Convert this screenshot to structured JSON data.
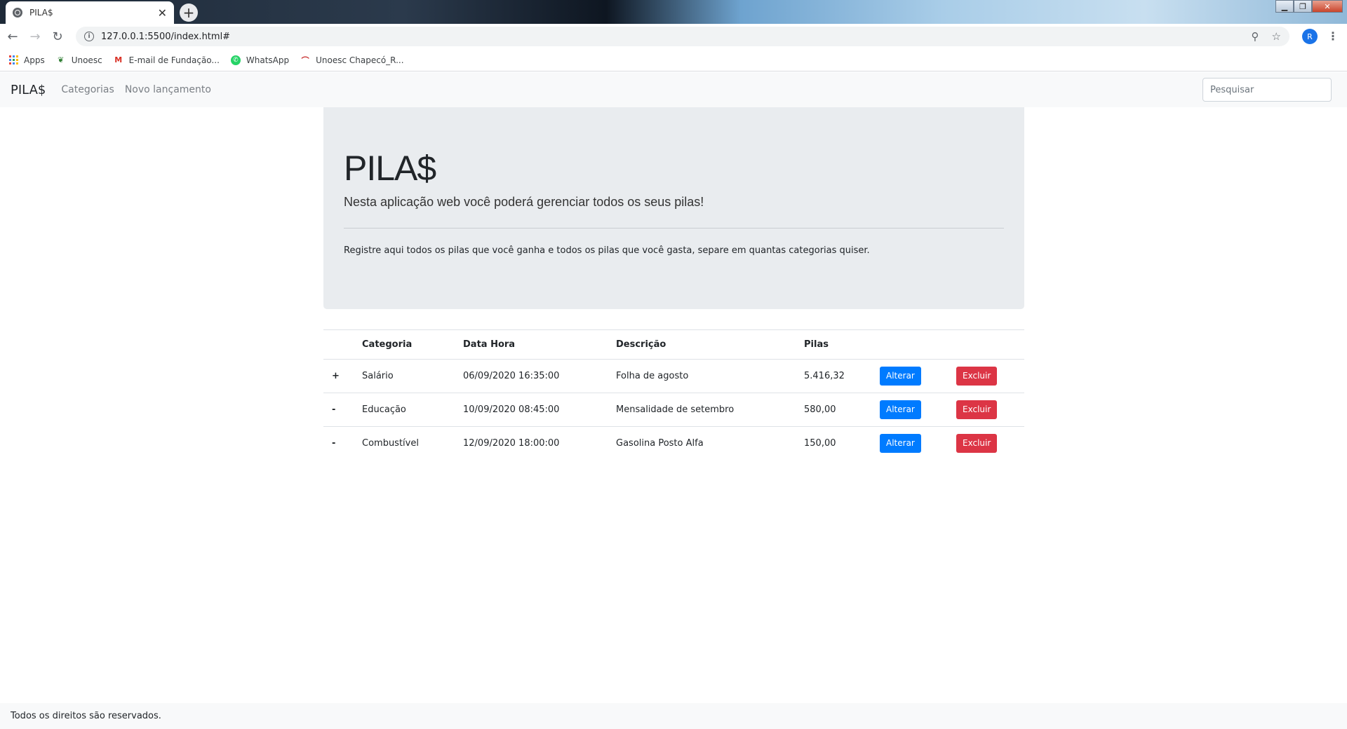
{
  "browser": {
    "tab_title": "PILA$",
    "tab_close": "✕",
    "new_tab": "+",
    "url": "127.0.0.1:5500/index.html#",
    "profile_initial": "R",
    "bookmarks": [
      {
        "label": "Apps",
        "icon": "apps-grid-icon"
      },
      {
        "label": "Unoesc",
        "icon": "unoesc-icon"
      },
      {
        "label": "E-mail de Fundação...",
        "icon": "gmail-icon"
      },
      {
        "label": "WhatsApp",
        "icon": "whatsapp-icon"
      },
      {
        "label": "Unoesc Chapecó_R...",
        "icon": "unoesc-chapeco-icon"
      }
    ]
  },
  "navbar": {
    "brand": "PILA$",
    "links": [
      "Categorias",
      "Novo lançamento"
    ],
    "search_placeholder": "Pesquisar"
  },
  "jumbotron": {
    "title": "PILA$",
    "lead": "Nesta aplicação web você poderá gerenciar todos os seus pilas!",
    "text": "Registre aqui todos os pilas que você ganha e todos os pilas que você gasta, separe em quantas categorias quiser."
  },
  "table": {
    "headers": [
      "",
      "Categoria",
      "Data Hora",
      "Descrição",
      "Pilas",
      "",
      ""
    ],
    "rows": [
      {
        "sign": "+",
        "categoria": "Salário",
        "data_hora": "06/09/2020 16:35:00",
        "descricao": "Folha de agosto",
        "pilas": "5.416,32",
        "alterar": "Alterar",
        "excluir": "Excluir"
      },
      {
        "sign": "-",
        "categoria": "Educação",
        "data_hora": "10/09/2020 08:45:00",
        "descricao": "Mensalidade de setembro",
        "pilas": "580,00",
        "alterar": "Alterar",
        "excluir": "Excluir"
      },
      {
        "sign": "-",
        "categoria": "Combustível",
        "data_hora": "12/09/2020 18:00:00",
        "descricao": "Gasolina Posto Alfa",
        "pilas": "150,00",
        "alterar": "Alterar",
        "excluir": "Excluir"
      }
    ]
  },
  "footer": {
    "text": "Todos os direitos são reservados."
  },
  "colors": {
    "primary": "#007bff",
    "danger": "#dc3545",
    "jumbotron_bg": "#e9ecef",
    "navbar_bg": "#f8f9fa"
  }
}
